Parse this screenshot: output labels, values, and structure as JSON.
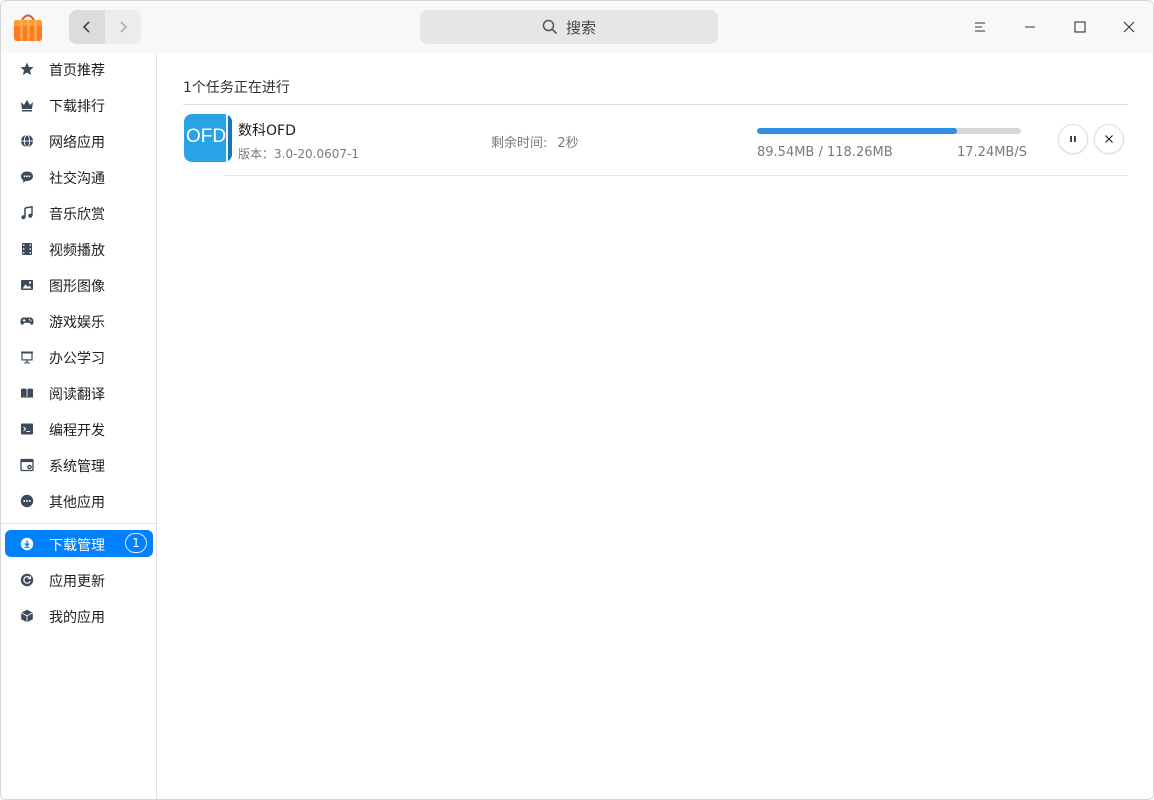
{
  "search": {
    "label": "搜索"
  },
  "sidebar": {
    "items": [
      {
        "label": "首页推荐",
        "icon": "star-icon"
      },
      {
        "label": "下载排行",
        "icon": "crown-icon"
      },
      {
        "label": "网络应用",
        "icon": "globe-icon"
      },
      {
        "label": "社交沟通",
        "icon": "chat-icon"
      },
      {
        "label": "音乐欣赏",
        "icon": "music-note-icon"
      },
      {
        "label": "视频播放",
        "icon": "film-icon"
      },
      {
        "label": "图形图像",
        "icon": "image-icon"
      },
      {
        "label": "游戏娱乐",
        "icon": "gamepad-icon"
      },
      {
        "label": "办公学习",
        "icon": "presentation-icon"
      },
      {
        "label": "阅读翻译",
        "icon": "book-icon"
      },
      {
        "label": "编程开发",
        "icon": "terminal-icon"
      },
      {
        "label": "系统管理",
        "icon": "system-settings-icon"
      },
      {
        "label": "其他应用",
        "icon": "more-icon"
      }
    ],
    "bottom_items": [
      {
        "label": "下载管理",
        "icon": "download-manager-icon",
        "badge": "1",
        "active": true
      },
      {
        "label": "应用更新",
        "icon": "refresh-icon"
      },
      {
        "label": "我的应用",
        "icon": "box-icon"
      }
    ]
  },
  "main": {
    "task_summary": "1个任务正在进行",
    "download": {
      "icon_text": "OFD",
      "name": "数科OFD",
      "version": "版本：3.0-20.0607-1",
      "remaining_label": "剩余时间:",
      "remaining_value": "2秒",
      "downloaded": "89.54MB / 118.26MB",
      "speed": "17.24MB/S",
      "progress_fraction": 0.757
    }
  },
  "colors": {
    "accent": "#0081ff",
    "progress": "#2f8ee6",
    "app_icon": "#2aa3e6"
  }
}
